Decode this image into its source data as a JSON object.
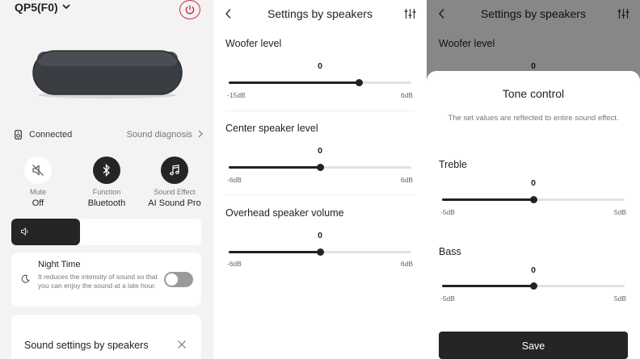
{
  "device": {
    "title": "QP5(F0)",
    "status": "Connected",
    "diagnosis_link": "Sound diagnosis",
    "quick_controls": [
      {
        "label": "Mute",
        "value": "Off",
        "icon": "mute-speaker-icon"
      },
      {
        "label": "Function",
        "value": "Bluetooth",
        "icon": "bluetooth-icon"
      },
      {
        "label": "Sound Effect",
        "value": "AI Sound Pro",
        "icon": "music-note-icon"
      }
    ],
    "volume_fraction": 0.36,
    "night_time": {
      "title": "Night Time",
      "description": "It reduces the intensity of sound so that you can enjoy the sound at a late hour.",
      "enabled": false
    },
    "speaker_settings_card": "Sound settings by speakers"
  },
  "settings_panel": {
    "title": "Settings by speakers",
    "sliders": [
      {
        "label": "Woofer level",
        "value": "0",
        "min": "-15dB",
        "max": "6dB",
        "min_num": -15,
        "max_num": 6,
        "num": 0
      },
      {
        "label": "Center speaker level",
        "value": "0",
        "min": "-6dB",
        "max": "6dB",
        "min_num": -6,
        "max_num": 6,
        "num": 0
      },
      {
        "label": "Overhead speaker volume",
        "value": "0",
        "min": "-6dB",
        "max": "6dB",
        "min_num": -6,
        "max_num": 6,
        "num": 0
      }
    ]
  },
  "tone_panel": {
    "header_title": "Settings by speakers",
    "background_label": "Woofer level",
    "background_value": "0",
    "title": "Tone control",
    "description": "The set values are reflected to entire sound effect.",
    "sliders": [
      {
        "label": "Treble",
        "value": "0",
        "min": "-5dB",
        "max": "5dB",
        "min_num": -5,
        "max_num": 5,
        "num": 0
      },
      {
        "label": "Bass",
        "value": "0",
        "min": "-5dB",
        "max": "5dB",
        "min_num": -5,
        "max_num": 5,
        "num": 0
      }
    ],
    "save_label": "Save"
  },
  "colors": {
    "accent_power": "#c6304a",
    "dark": "#252525",
    "panel_bg": "#f4f2f3"
  }
}
